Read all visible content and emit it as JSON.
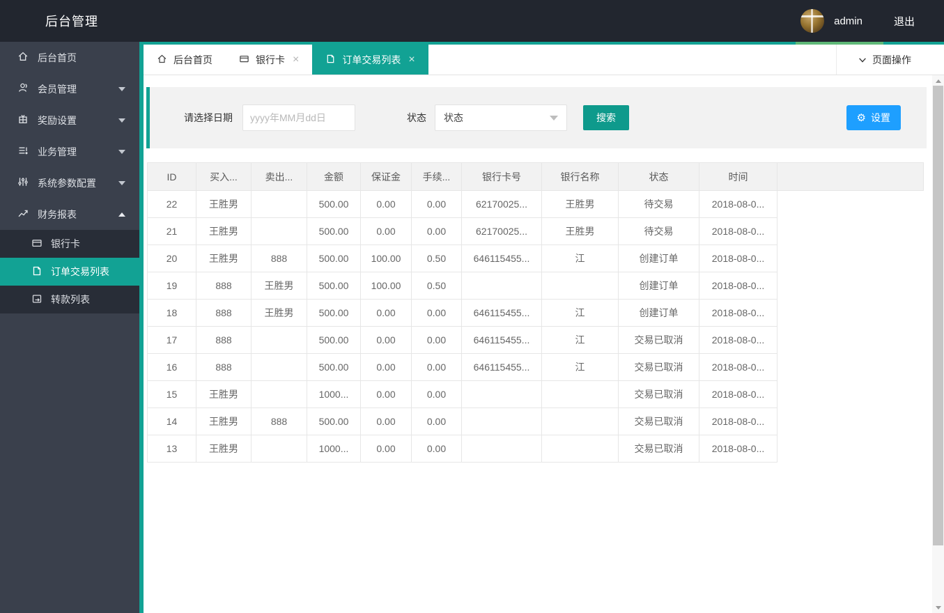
{
  "colors": {
    "accent": "#12a294",
    "accent_light": "#5fb878",
    "button_blue": "#1e9fff"
  },
  "icons": {
    "close": "×",
    "gear": "⚙"
  },
  "header": {
    "title": "后台管理",
    "username": "admin",
    "logout_label": "退出"
  },
  "sidebar": {
    "items": [
      {
        "label": "后台首页",
        "icon": "home-icon"
      },
      {
        "label": "会员管理",
        "icon": "members-icon",
        "expandable": true
      },
      {
        "label": "奖励设置",
        "icon": "reward-icon",
        "expandable": true
      },
      {
        "label": "业务管理",
        "icon": "business-icon",
        "expandable": true
      },
      {
        "label": "系统参数配置",
        "icon": "params-icon",
        "expandable": true
      },
      {
        "label": "财务报表",
        "icon": "finance-icon",
        "expandable": true,
        "expanded": true
      }
    ],
    "subitems": [
      {
        "label": "银行卡",
        "icon": "bankcard-icon",
        "active": false
      },
      {
        "label": "订单交易列表",
        "icon": "orders-icon",
        "active": true
      },
      {
        "label": "转款列表",
        "icon": "transfer-icon",
        "active": false
      }
    ]
  },
  "tabs": {
    "items": [
      {
        "label": "后台首页",
        "icon": "home-icon",
        "closable": false,
        "active": false
      },
      {
        "label": "银行卡",
        "icon": "bankcard-icon",
        "closable": true,
        "active": false
      },
      {
        "label": "订单交易列表",
        "icon": "orders-icon",
        "closable": true,
        "active": true
      }
    ],
    "page_actions_label": "页面操作"
  },
  "filter": {
    "date_label": "请选择日期",
    "date_placeholder": "yyyy年MM月dd日",
    "date_value": "",
    "status_label": "状态",
    "status_value": "状态",
    "search_label": "搜索",
    "settings_label": "设置"
  },
  "table": {
    "columns": [
      "ID",
      "买入...",
      "卖出...",
      "金额",
      "保证金",
      "手续...",
      "银行卡号",
      "银行名称",
      "状态",
      "时间"
    ],
    "rows": [
      [
        "22",
        "王胜男",
        "",
        "500.00",
        "0.00",
        "0.00",
        "62170025...",
        "王胜男",
        "待交易",
        "2018-08-0..."
      ],
      [
        "21",
        "王胜男",
        "",
        "500.00",
        "0.00",
        "0.00",
        "62170025...",
        "王胜男",
        "待交易",
        "2018-08-0..."
      ],
      [
        "20",
        "王胜男",
        "888",
        "500.00",
        "100.00",
        "0.50",
        "646115455...",
        "江",
        "创建订单",
        "2018-08-0..."
      ],
      [
        "19",
        "888",
        "王胜男",
        "500.00",
        "100.00",
        "0.50",
        "",
        "",
        "创建订单",
        "2018-08-0..."
      ],
      [
        "18",
        "888",
        "王胜男",
        "500.00",
        "0.00",
        "0.00",
        "646115455...",
        "江",
        "创建订单",
        "2018-08-0..."
      ],
      [
        "17",
        "888",
        "",
        "500.00",
        "0.00",
        "0.00",
        "646115455...",
        "江",
        "交易已取消",
        "2018-08-0..."
      ],
      [
        "16",
        "888",
        "",
        "500.00",
        "0.00",
        "0.00",
        "646115455...",
        "江",
        "交易已取消",
        "2018-08-0..."
      ],
      [
        "15",
        "王胜男",
        "",
        "1000...",
        "0.00",
        "0.00",
        "",
        "",
        "交易已取消",
        "2018-08-0..."
      ],
      [
        "14",
        "王胜男",
        "888",
        "500.00",
        "0.00",
        "0.00",
        "",
        "",
        "交易已取消",
        "2018-08-0..."
      ],
      [
        "13",
        "王胜男",
        "",
        "1000...",
        "0.00",
        "0.00",
        "",
        "",
        "交易已取消",
        "2018-08-0..."
      ]
    ]
  }
}
